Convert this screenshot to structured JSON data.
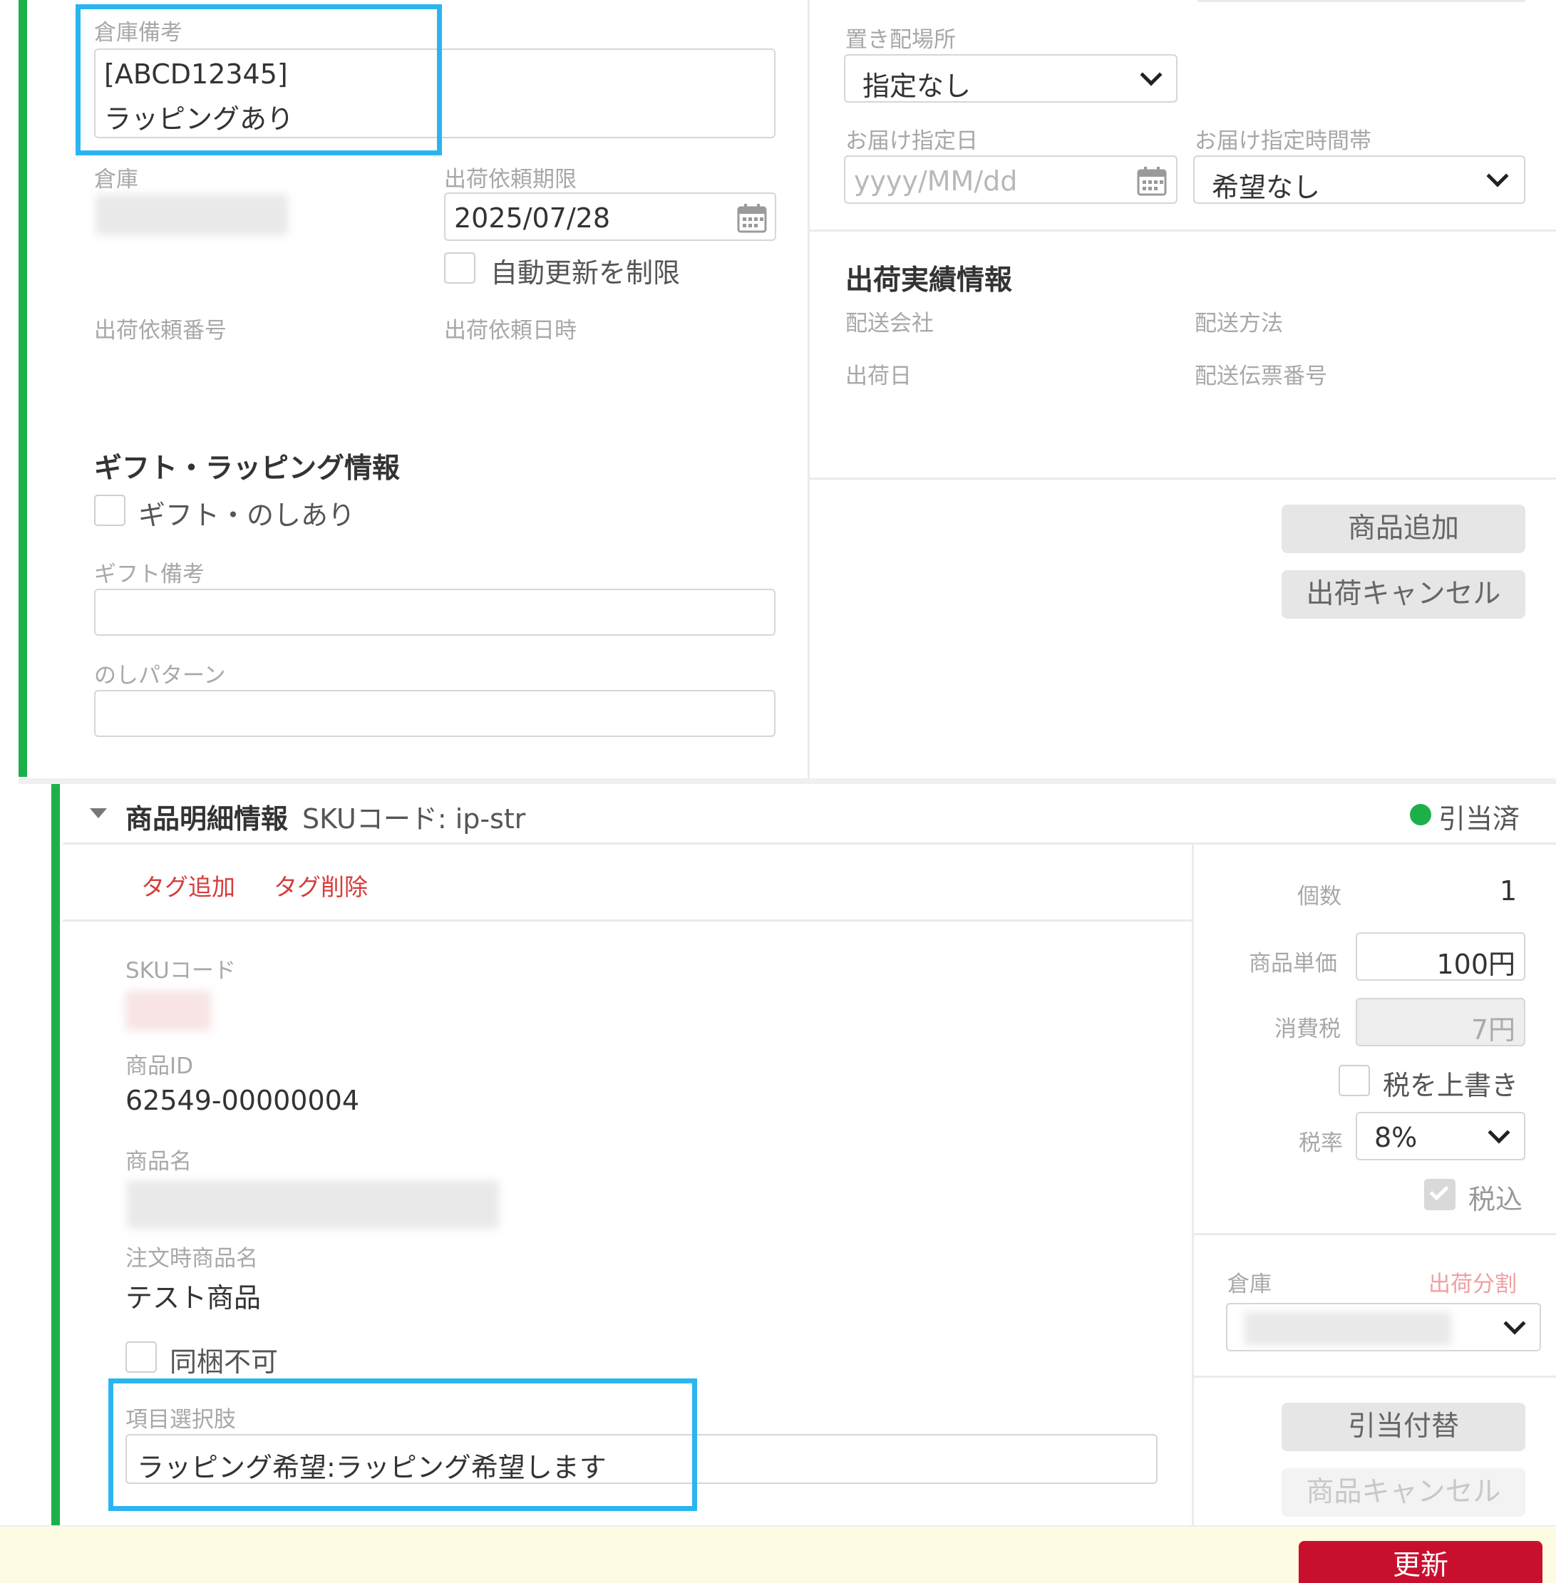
{
  "colors": {
    "accent_green": "#1db04a",
    "highlight_blue": "#2bb5f0",
    "danger_red": "#c8102e",
    "link_red": "#d63c3c",
    "footer_bg": "#fdfbe2"
  },
  "upper_left": {
    "warehouse_note_label": "倉庫備考",
    "warehouse_note_line1": "[ABCD12345]",
    "warehouse_note_line2": "ラッピングあり",
    "warehouse_label": "倉庫",
    "ship_deadline_label": "出荷依頼期限",
    "ship_deadline_value": "2025/07/28",
    "restrict_auto_update_label": "自動更新を制限",
    "ship_request_no_label": "出荷依頼番号",
    "ship_request_datetime_label": "出荷依頼日時",
    "gift_section_title": "ギフト・ラッピング情報",
    "gift_noshi_label": "ギフト・のしあり",
    "gift_note_label": "ギフト備考",
    "noshi_pattern_label": "のしパターン"
  },
  "upper_right": {
    "drop_location_label": "置き配場所",
    "drop_location_value": "指定なし",
    "delivery_date_label": "お届け指定日",
    "delivery_date_placeholder": "yyyy/MM/dd",
    "delivery_time_label": "お届け指定時間帯",
    "delivery_time_value": "希望なし",
    "shipment_result_title": "出荷実績情報",
    "carrier_label": "配送会社",
    "delivery_method_label": "配送方法",
    "ship_date_label": "出荷日",
    "tracking_no_label": "配送伝票番号",
    "add_product_button": "商品追加",
    "cancel_shipment_button": "出荷キャンセル"
  },
  "item": {
    "header_title": "商品明細情報",
    "header_sku": "SKUコード: ip-str",
    "status": "引当済",
    "add_tag": "タグ追加",
    "remove_tag": "タグ削除",
    "sku_label": "SKUコード",
    "product_id_label": "商品ID",
    "product_id_value": "62549-00000004",
    "product_name_label": "商品名",
    "order_product_name_label": "注文時商品名",
    "order_product_name_value": "テスト商品",
    "no_bundle_label": "同梱不可",
    "option_label": "項目選択肢",
    "option_value": "ラッピング希望:ラッピング希望します",
    "quantity_label": "個数",
    "quantity_value": "1",
    "unit_price_label": "商品単価",
    "unit_price_value": "100円",
    "tax_label": "消費税",
    "tax_value": "7円",
    "override_tax_label": "税を上書き",
    "tax_rate_label": "税率",
    "tax_rate_value": "8%",
    "tax_included_label": "税込",
    "warehouse_label": "倉庫",
    "split_shipment_link": "出荷分割",
    "reallocate_button": "引当付替",
    "cancel_item_button": "商品キャンセル"
  },
  "footer": {
    "update_button": "更新"
  }
}
